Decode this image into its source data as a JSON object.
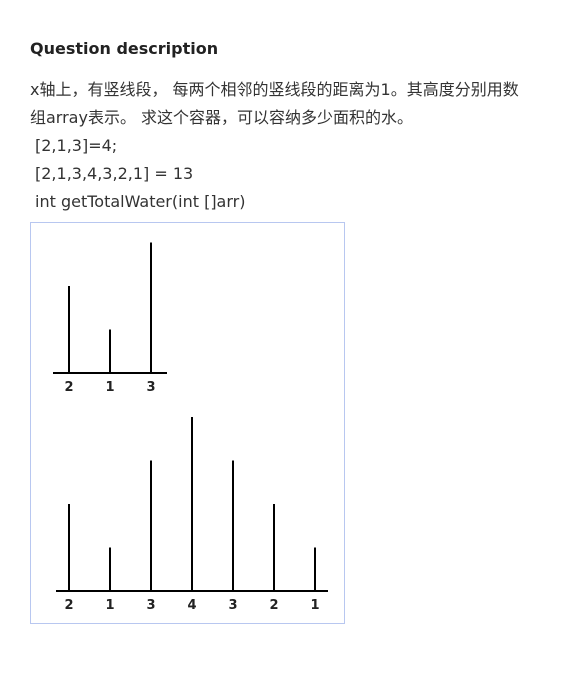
{
  "question": {
    "heading": "Question description",
    "description_line1": "x轴上，有竖线段， 每两个相邻的竖线段的距离为1。其高度分别用数",
    "description_line2": "组array表示。 求这个容器，可以容纳多少面积的水。",
    "example1": "[2,1,3]=4;",
    "example2": "[2,1,3,4,3,2,1] = 13",
    "signature": "int getTotalWater(int []arr)"
  },
  "figure": {
    "diagrams": [
      {
        "heights": [
          2,
          1,
          3
        ],
        "labels": [
          "2",
          "1",
          "3"
        ]
      },
      {
        "heights": [
          2,
          1,
          3,
          4,
          3,
          2,
          1
        ],
        "labels": [
          "2",
          "1",
          "3",
          "4",
          "3",
          "2",
          "1"
        ]
      }
    ],
    "colors": {
      "border": "#b8c7f0",
      "line": "#000000"
    }
  }
}
